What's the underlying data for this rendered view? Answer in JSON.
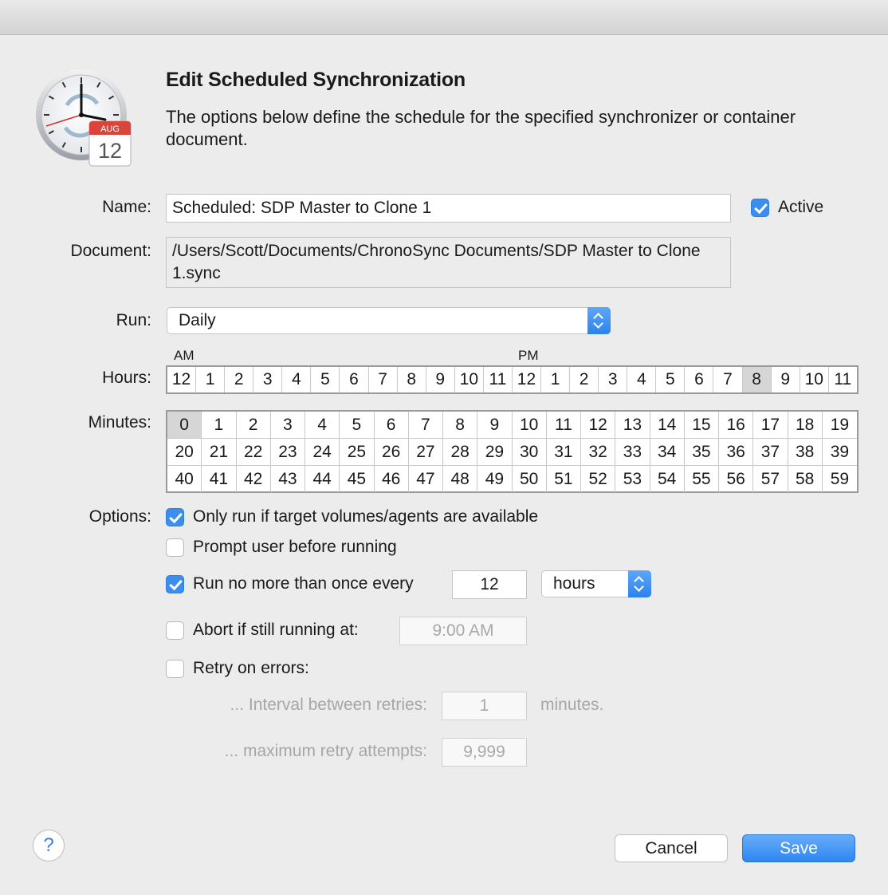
{
  "dialog": {
    "title": "Edit Scheduled Synchronization",
    "description": "The options below define the schedule for the specified synchronizer or container document."
  },
  "icon": {
    "month": "AUG",
    "day": "12"
  },
  "fields": {
    "name_label": "Name:",
    "name_value": "Scheduled: SDP Master to Clone 1",
    "active_label": "Active",
    "active_checked": true,
    "document_label": "Document:",
    "document_value": "/Users/Scott/Documents/ChronoSync Documents/SDP Master to Clone 1.sync",
    "run_label": "Run:",
    "run_value": "Daily"
  },
  "hours": {
    "label": "Hours:",
    "am_label": "AM",
    "pm_label": "PM",
    "values": [
      "12",
      "1",
      "2",
      "3",
      "4",
      "5",
      "6",
      "7",
      "8",
      "9",
      "10",
      "11",
      "12",
      "1",
      "2",
      "3",
      "4",
      "5",
      "6",
      "7",
      "8",
      "9",
      "10",
      "11"
    ],
    "selected_index": 20
  },
  "minutes": {
    "label": "Minutes:",
    "values": [
      "0",
      "1",
      "2",
      "3",
      "4",
      "5",
      "6",
      "7",
      "8",
      "9",
      "10",
      "11",
      "12",
      "13",
      "14",
      "15",
      "16",
      "17",
      "18",
      "19",
      "20",
      "21",
      "22",
      "23",
      "24",
      "25",
      "26",
      "27",
      "28",
      "29",
      "30",
      "31",
      "32",
      "33",
      "34",
      "35",
      "36",
      "37",
      "38",
      "39",
      "40",
      "41",
      "42",
      "43",
      "44",
      "45",
      "46",
      "47",
      "48",
      "49",
      "50",
      "51",
      "52",
      "53",
      "54",
      "55",
      "56",
      "57",
      "58",
      "59"
    ],
    "selected_index": 0
  },
  "options": {
    "label": "Options:",
    "only_run_label": "Only run if target volumes/agents are available",
    "only_run_checked": true,
    "prompt_label": "Prompt user before running",
    "prompt_checked": false,
    "run_no_more_label": "Run no more than once every",
    "run_no_more_checked": true,
    "run_no_more_value": "12",
    "run_no_more_unit": "hours",
    "abort_label": "Abort if still running at:",
    "abort_checked": false,
    "abort_value": "9:00 AM",
    "retry_label": "Retry on errors:",
    "retry_checked": false,
    "interval_label": "... Interval between retries:",
    "interval_value": "1",
    "interval_unit": "minutes.",
    "max_retry_label": "... maximum retry attempts:",
    "max_retry_value": "9,999"
  },
  "buttons": {
    "help": "?",
    "cancel": "Cancel",
    "save": "Save"
  },
  "colors": {
    "accent": "#3b8ef0",
    "background": "#ececec"
  }
}
